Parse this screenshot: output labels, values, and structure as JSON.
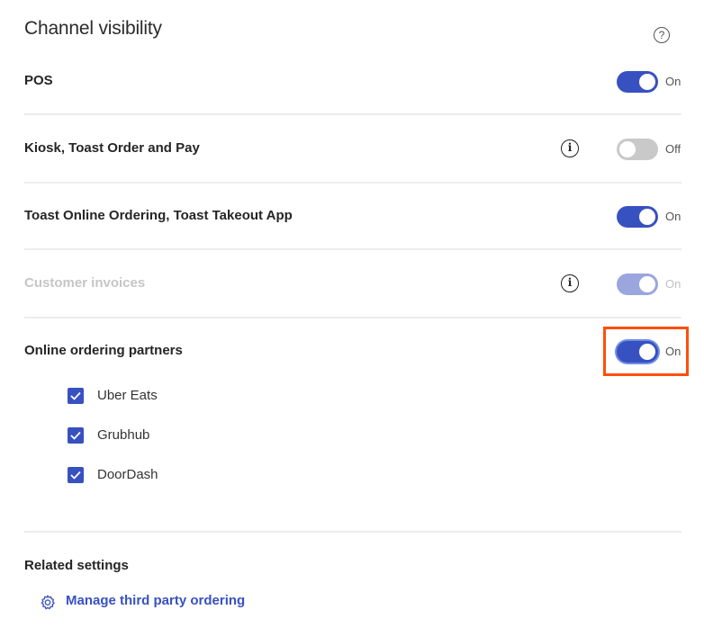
{
  "header": {
    "title": "Channel visibility",
    "help_icon": "?"
  },
  "channels": [
    {
      "label": "POS",
      "state": "On",
      "enabled": true,
      "disabled": false,
      "info": false
    },
    {
      "label": "Kiosk, Toast Order and Pay",
      "state": "Off",
      "enabled": false,
      "disabled": false,
      "info": true
    },
    {
      "label": "Toast Online Ordering, Toast Takeout App",
      "state": "On",
      "enabled": true,
      "disabled": false,
      "info": false
    },
    {
      "label": "Customer invoices",
      "state": "On",
      "enabled": true,
      "disabled": true,
      "info": true
    },
    {
      "label": "Online ordering partners",
      "state": "On",
      "enabled": true,
      "disabled": false,
      "info": false,
      "highlighted": true
    }
  ],
  "partners": [
    {
      "label": "Uber Eats",
      "checked": true
    },
    {
      "label": "Grubhub",
      "checked": true
    },
    {
      "label": "DoorDash",
      "checked": true
    }
  ],
  "related": {
    "heading": "Related settings",
    "link_label": "Manage third party ordering"
  },
  "info_glyph": "i",
  "colors": {
    "accent": "#3851c0",
    "highlight": "#ff4f0a"
  }
}
